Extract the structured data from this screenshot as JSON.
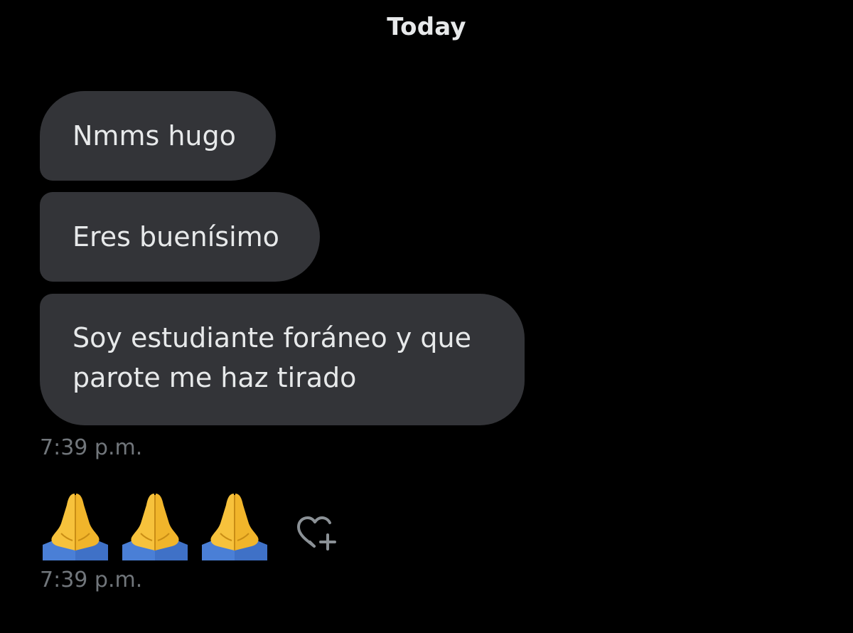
{
  "conversation": {
    "day_divider": "Today",
    "messages": [
      {
        "text": "Nmms hugo"
      },
      {
        "text": "Eres buenísimo"
      },
      {
        "lines": [
          "Soy estudiante foráneo y que",
          "parote me haz tirado"
        ]
      }
    ],
    "group_timestamp": "7:39 p.m.",
    "emoji_message": {
      "emojis": [
        "folded-hands-emoji",
        "folded-hands-emoji",
        "folded-hands-emoji"
      ],
      "timestamp": "7:39 p.m."
    },
    "react_button_icon": "heart-plus-icon"
  },
  "colors": {
    "background": "#000000",
    "bubble": "#333438",
    "text": "#e7e9ea",
    "timestamp": "#71767b"
  }
}
